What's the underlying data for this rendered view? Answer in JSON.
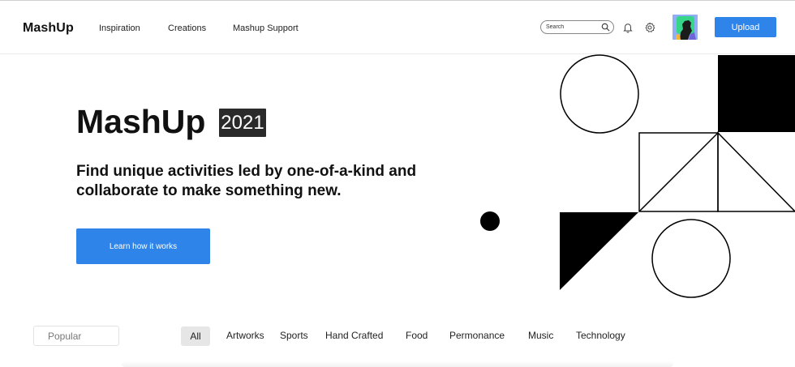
{
  "header": {
    "logo": "MashUp",
    "nav": [
      {
        "label": "Inspiration"
      },
      {
        "label": "Creations"
      },
      {
        "label": "Mashup Support"
      }
    ],
    "search_placeholder": "Search",
    "upload_label": "Upload",
    "icons": [
      "search-icon",
      "bell-icon",
      "gear-icon"
    ]
  },
  "hero": {
    "title": "MashUp",
    "year": "2021",
    "subtitle": "Find unique activities led by one-of-a-kind and collaborate to make something new.",
    "cta_label": "Learn how it works"
  },
  "filters": {
    "sort_value": "Popular",
    "categories": [
      "All",
      "Artworks",
      "Sports",
      "Hand Crafted",
      "Food",
      "Permonance",
      "Music",
      "Technology"
    ],
    "active_category": "All"
  },
  "colors": {
    "accent": "#2f84ea",
    "badge": "#2a2a2a",
    "avatar_bg": "#8faef6"
  }
}
